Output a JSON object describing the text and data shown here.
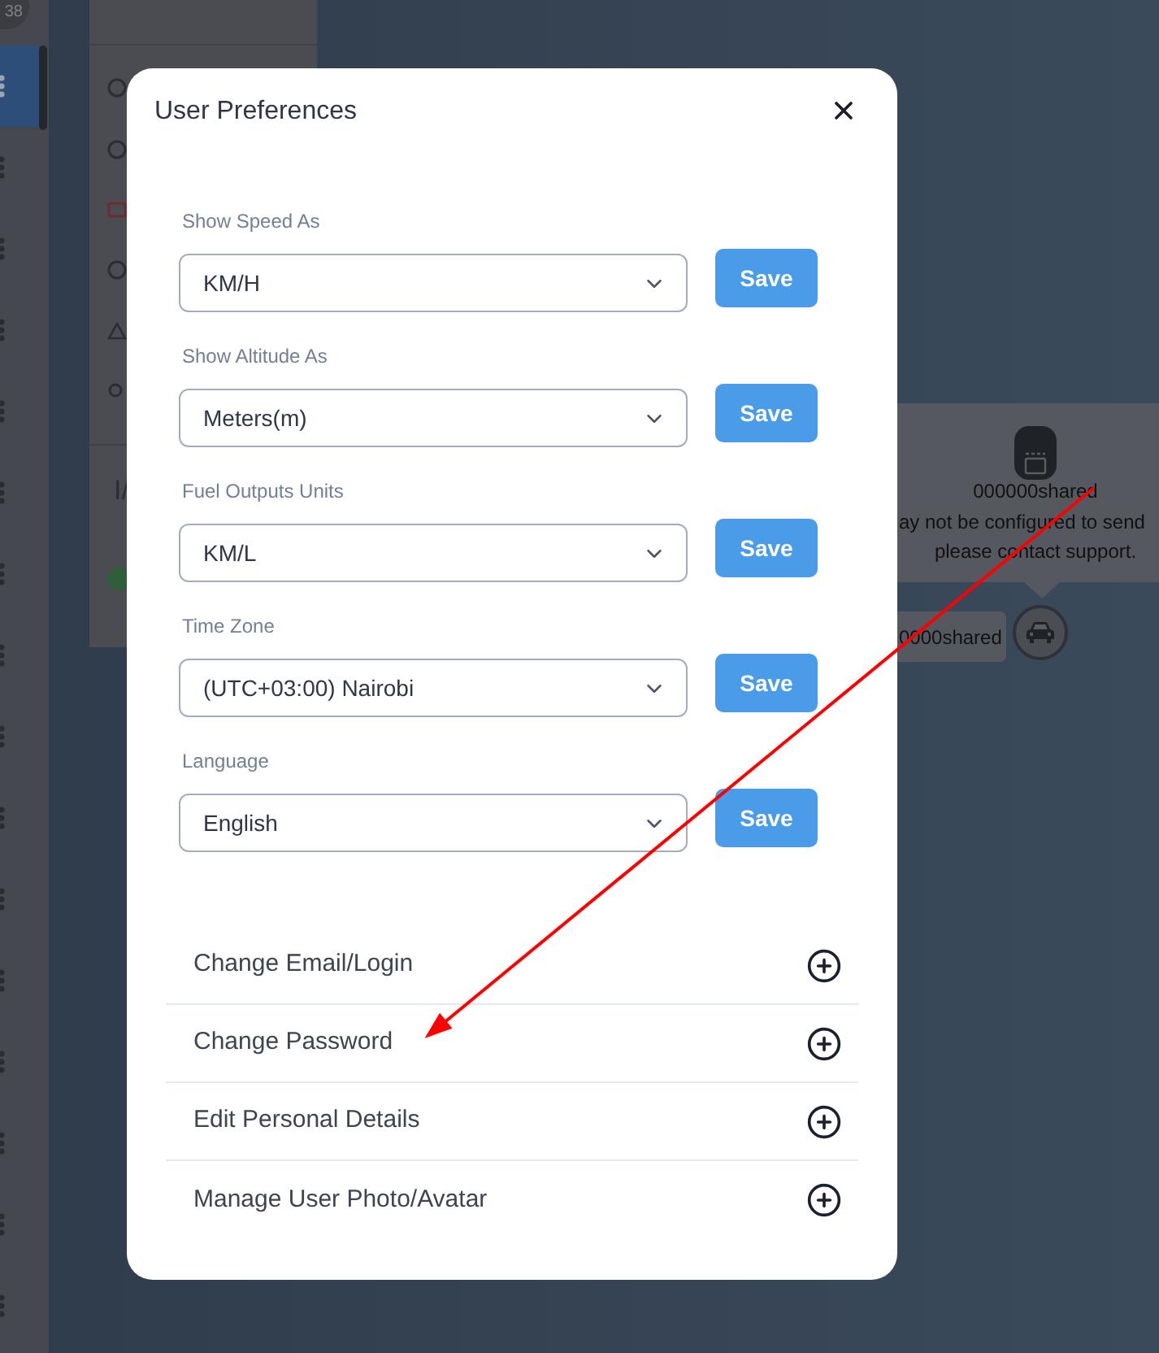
{
  "sidebar": {
    "badge": "38",
    "items": [
      {
        "selected": true
      },
      {
        "selected": false
      },
      {
        "selected": false
      },
      {
        "selected": false
      },
      {
        "selected": false
      },
      {
        "selected": false
      },
      {
        "selected": false
      },
      {
        "selected": false
      },
      {
        "selected": false
      },
      {
        "selected": false
      },
      {
        "selected": false
      },
      {
        "selected": false
      },
      {
        "selected": false
      },
      {
        "selected": false
      },
      {
        "selected": false
      },
      {
        "selected": false
      }
    ]
  },
  "side_panel": {
    "text": "I/"
  },
  "map": {
    "popup": {
      "title": "000000shared",
      "lines": [
        "ay not be configured to send",
        "please contact support."
      ]
    },
    "vehicle_label": "0000shared"
  },
  "dialog": {
    "title": "User Preferences",
    "settings": [
      {
        "label": "Show Speed As",
        "value": "KM/H",
        "button": "Save"
      },
      {
        "label": "Show Altitude As",
        "value": "Meters(m)",
        "button": "Save"
      },
      {
        "label": "Fuel Outputs Units",
        "value": "KM/L",
        "button": "Save"
      },
      {
        "label": "Time Zone",
        "value": "(UTC+03:00) Nairobi",
        "button": "Save"
      },
      {
        "label": "Language",
        "value": "English",
        "button": "Save"
      }
    ],
    "sections": [
      {
        "label": "Change Email/Login",
        "expanded": false
      },
      {
        "label": "Change Password",
        "expanded": false
      },
      {
        "label": "Edit Personal Details",
        "expanded": false
      },
      {
        "label": "Manage User Photo/Avatar",
        "expanded": false
      }
    ]
  }
}
